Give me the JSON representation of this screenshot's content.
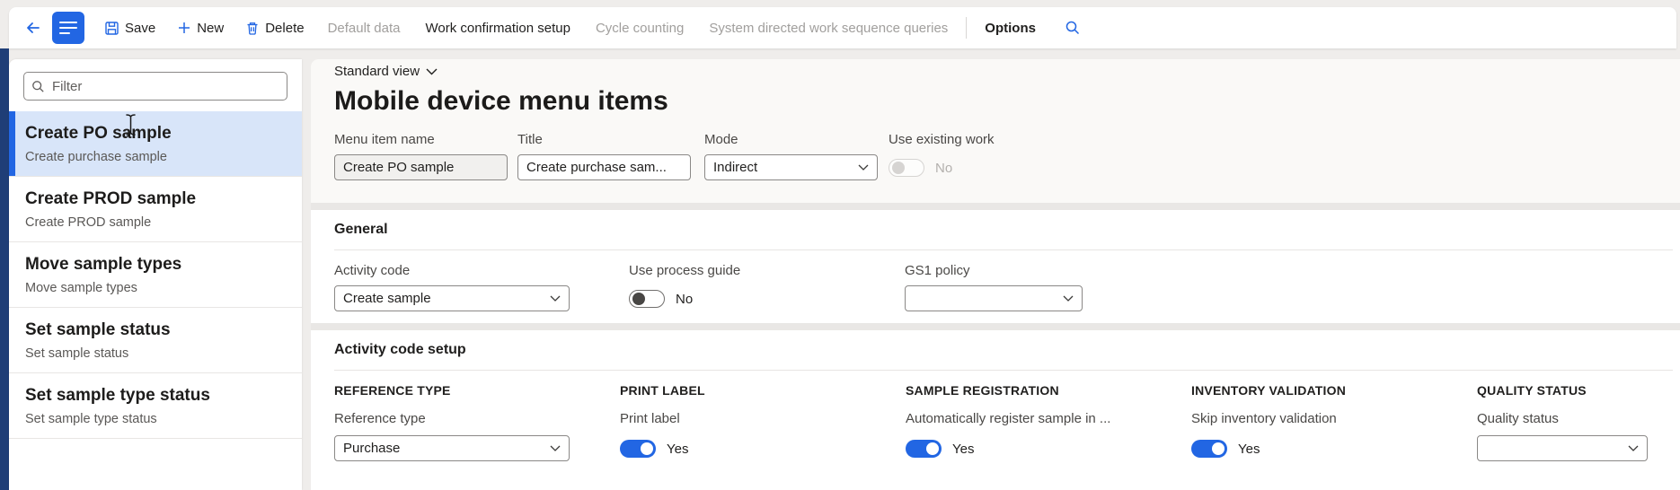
{
  "toolbar": {
    "save_label": "Save",
    "new_label": "New",
    "delete_label": "Delete",
    "menu_items": [
      {
        "label": "Default data",
        "enabled": false
      },
      {
        "label": "Work confirmation setup",
        "enabled": true
      },
      {
        "label": "Cycle counting",
        "enabled": false
      },
      {
        "label": "System directed work sequence queries",
        "enabled": false
      },
      {
        "label": "Options",
        "enabled": true
      }
    ],
    "icons": {
      "back": "arrow-left",
      "menu": "hamburger",
      "save": "floppy-disk",
      "new": "plus",
      "delete": "trash",
      "search": "magnifier"
    },
    "accent_color": "#2266e3"
  },
  "sidebar": {
    "filter_placeholder": "Filter",
    "items": [
      {
        "title": "Create PO sample",
        "subtitle": "Create purchase sample",
        "selected": true
      },
      {
        "title": "Create PROD sample",
        "subtitle": "Create PROD sample",
        "selected": false
      },
      {
        "title": "Move sample types",
        "subtitle": "Move sample types",
        "selected": false
      },
      {
        "title": "Set sample status",
        "subtitle": "Set sample status",
        "selected": false
      },
      {
        "title": "Set sample type status",
        "subtitle": "Set sample type status",
        "selected": false
      }
    ],
    "selected_bg": "#d8e5f9",
    "accent_bar_color": "#2266e3"
  },
  "header": {
    "view_label": "Standard view",
    "title": "Mobile device menu items",
    "fields": {
      "menu_item_name": {
        "label": "Menu item name",
        "value": "Create PO sample"
      },
      "title_field": {
        "label": "Title",
        "value": "Create purchase sam..."
      },
      "mode": {
        "label": "Mode",
        "value": "Indirect"
      },
      "use_existing_work": {
        "label": "Use existing work",
        "value": "No",
        "state": "off-disabled"
      }
    }
  },
  "general": {
    "title": "General",
    "fields": {
      "activity_code": {
        "label": "Activity code",
        "value": "Create sample"
      },
      "use_process_guide": {
        "label": "Use process guide",
        "value": "No",
        "state": "off"
      },
      "gs1_policy": {
        "label": "GS1 policy",
        "value": ""
      }
    }
  },
  "activity_setup": {
    "title": "Activity code setup",
    "groups": [
      {
        "header": "REFERENCE TYPE",
        "label": "Reference type",
        "value": "Purchase",
        "control": "select"
      },
      {
        "header": "PRINT LABEL",
        "label": "Print label",
        "value": "Yes",
        "control": "toggle-on"
      },
      {
        "header": "SAMPLE REGISTRATION",
        "label": "Automatically register sample in ...",
        "value": "Yes",
        "control": "toggle-on"
      },
      {
        "header": "INVENTORY VALIDATION",
        "label": "Skip inventory validation",
        "value": "Yes",
        "control": "toggle-on"
      },
      {
        "header": "QUALITY STATUS",
        "label": "Quality status",
        "value": "",
        "control": "select"
      }
    ]
  },
  "colors": {
    "accent": "#2266e3",
    "nav_strip": "#1f3e77",
    "toggle_on": "#2266e3",
    "page_background": "#efedeb"
  }
}
